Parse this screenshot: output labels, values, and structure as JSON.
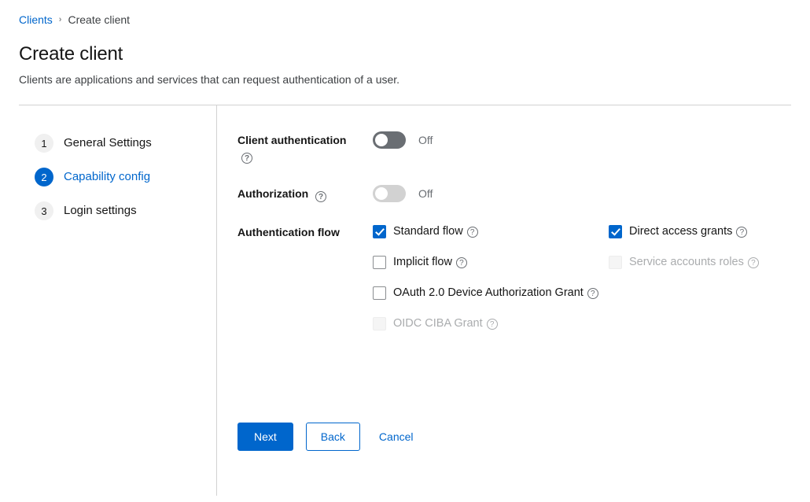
{
  "breadcrumb": {
    "parent": "Clients",
    "separator": "›",
    "current": "Create client"
  },
  "header": {
    "title": "Create client",
    "subtitle": "Clients are applications and services that can request authentication of a user."
  },
  "colors": {
    "accent": "#0066cc",
    "toggle_on_track": "#6a6e73",
    "toggle_disabled_track": "#d2d2d2",
    "muted_text": "#6a6e73",
    "disabled_text": "#aaacae",
    "divider": "#d2d2d2"
  },
  "wizard": {
    "steps": [
      {
        "number": "1",
        "label": "General Settings",
        "active": false
      },
      {
        "number": "2",
        "label": "Capability config",
        "active": true
      },
      {
        "number": "3",
        "label": "Login settings",
        "active": false
      }
    ]
  },
  "form": {
    "client_authentication": {
      "label": "Client authentication",
      "help_icon": "help-circle-icon",
      "state_text": "Off",
      "enabled": true,
      "checked": false
    },
    "authorization": {
      "label": "Authorization",
      "help_icon": "help-circle-icon",
      "state_text": "Off",
      "enabled": false,
      "checked": false
    },
    "authentication_flow": {
      "label": "Authentication flow",
      "options": [
        {
          "label": "Standard flow",
          "checked": true,
          "enabled": true,
          "help_icon": "help-circle-icon",
          "column": "left"
        },
        {
          "label": "Direct access grants",
          "checked": true,
          "enabled": true,
          "help_icon": "help-circle-icon",
          "column": "right"
        },
        {
          "label": "Implicit flow",
          "checked": false,
          "enabled": true,
          "help_icon": "help-circle-icon",
          "column": "left"
        },
        {
          "label": "Service accounts roles",
          "checked": false,
          "enabled": false,
          "help_icon": "help-circle-icon",
          "column": "right"
        },
        {
          "label": "OAuth 2.0 Device Authorization Grant",
          "checked": false,
          "enabled": true,
          "help_icon": "help-circle-icon",
          "column": "full"
        },
        {
          "label": "OIDC CIBA Grant",
          "checked": false,
          "enabled": false,
          "help_icon": "help-circle-icon",
          "column": "full"
        }
      ]
    }
  },
  "footer": {
    "next_label": "Next",
    "back_label": "Back",
    "cancel_label": "Cancel"
  },
  "icons": {
    "help": "?"
  }
}
